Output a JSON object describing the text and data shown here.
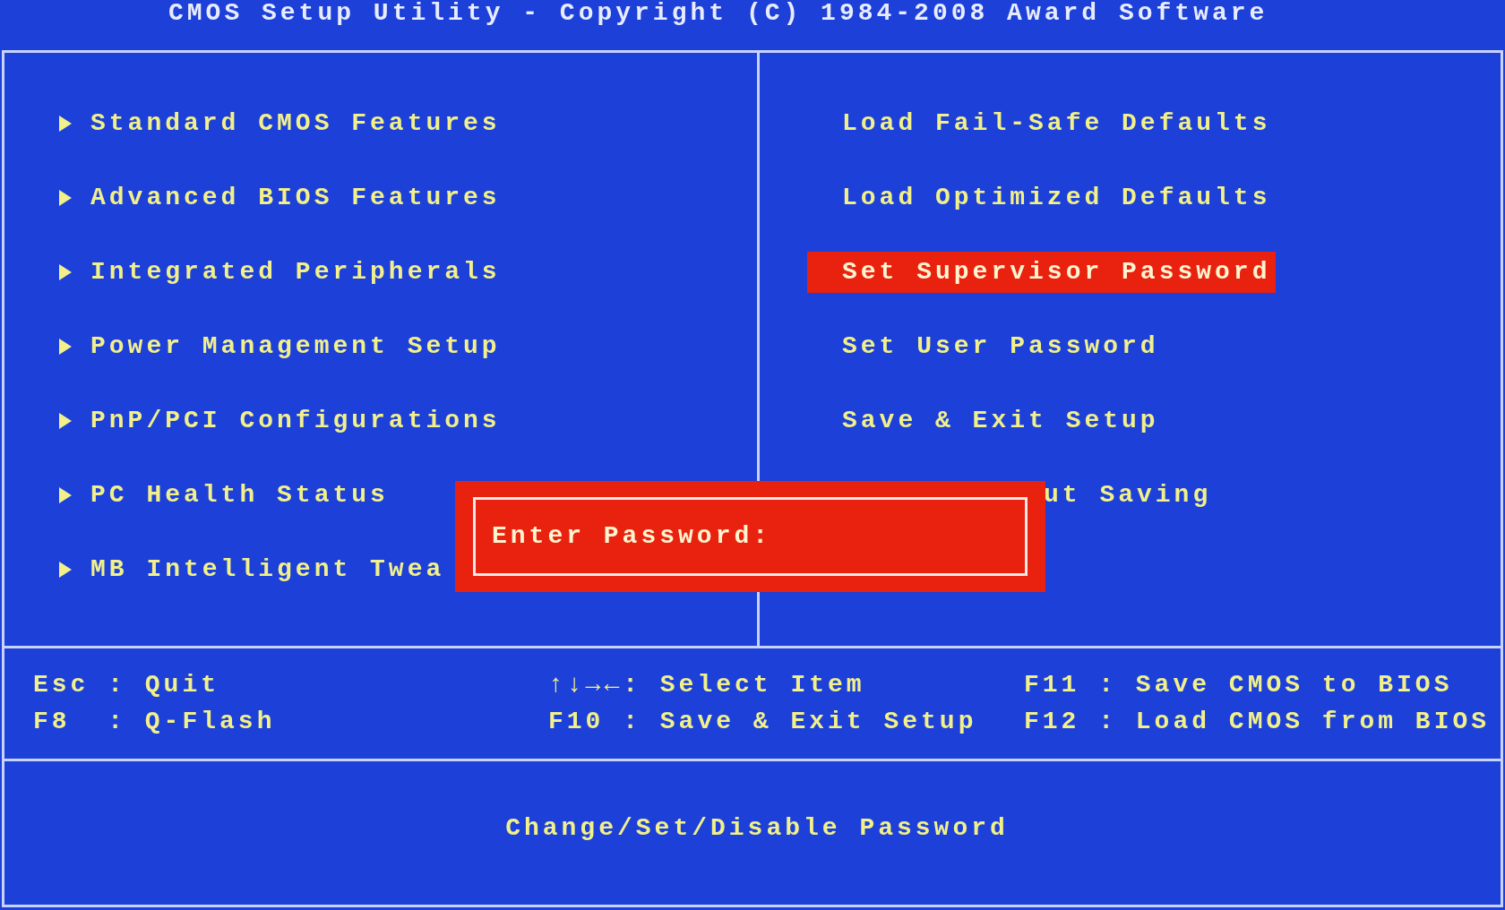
{
  "title": "CMOS Setup Utility - Copyright (C) 1984-2008 Award Software",
  "left_menu": [
    {
      "label": "Standard CMOS Features",
      "selected": false
    },
    {
      "label": "Advanced BIOS Features",
      "selected": false
    },
    {
      "label": "Integrated Peripherals",
      "selected": false
    },
    {
      "label": "Power Management Setup",
      "selected": false
    },
    {
      "label": "PnP/PCI Configurations",
      "selected": false
    },
    {
      "label": "PC Health Status",
      "selected": false
    },
    {
      "label": "MB Intelligent Twea",
      "selected": false
    }
  ],
  "right_menu": [
    {
      "label": "Load Fail-Safe Defaults",
      "selected": false,
      "kind": "full"
    },
    {
      "label": "Load Optimized Defaults",
      "selected": false,
      "kind": "full"
    },
    {
      "label": "Set Supervisor Password",
      "selected": true,
      "kind": "full"
    },
    {
      "label": "Set User Password",
      "selected": false,
      "kind": "full"
    },
    {
      "label": "Save & Exit Setup",
      "selected": false,
      "kind": "full"
    },
    {
      "label": "ut Saving",
      "selected": false,
      "kind": "obscured"
    }
  ],
  "dialog": {
    "label": "Enter Password:"
  },
  "key_legend": [
    [
      "Esc : Quit",
      "F8  : Q-Flash"
    ],
    [
      "↑↓→←: Select Item",
      "F10 : Save & Exit Setup"
    ],
    [
      "F11 : Save CMOS to BIOS",
      "F12 : Load CMOS from BIOS"
    ]
  ],
  "help_text": "Change/Set/Disable Password"
}
